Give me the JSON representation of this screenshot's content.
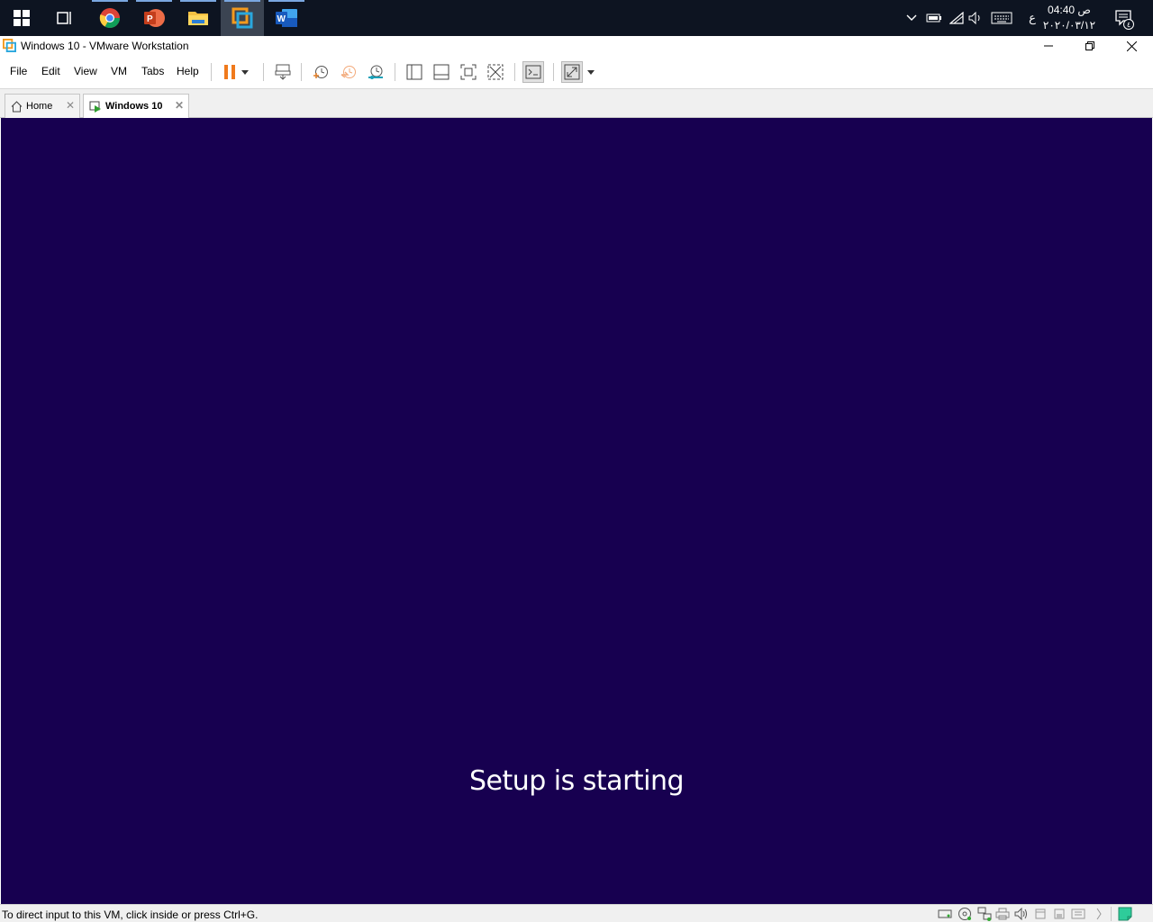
{
  "taskbar": {
    "apps": [
      {
        "name": "start-icon"
      },
      {
        "name": "task-view-icon"
      },
      {
        "name": "chrome-icon"
      },
      {
        "name": "powerpoint-icon"
      },
      {
        "name": "file-explorer-icon"
      },
      {
        "name": "vmware-icon"
      },
      {
        "name": "word-icon"
      }
    ],
    "tray": {
      "language": "ع",
      "time": "04:40 ص",
      "date": "٢٠٢٠/٠٣/١٢",
      "notification_count": "٤"
    }
  },
  "window": {
    "title": "Windows 10 - VMware Workstation"
  },
  "menu": {
    "file": "File",
    "edit": "Edit",
    "view": "View",
    "vm": "VM",
    "tabs": "Tabs",
    "help": "Help"
  },
  "tabs": [
    {
      "label": "Home"
    },
    {
      "label": "Windows 10"
    }
  ],
  "vm_screen": {
    "message": "Setup is starting",
    "background": "#170050"
  },
  "status": {
    "text": "To direct input to this VM, click inside or press Ctrl+G."
  },
  "colors": {
    "pause_accent": "#f07a1c",
    "taskbar": "#0d1421"
  }
}
